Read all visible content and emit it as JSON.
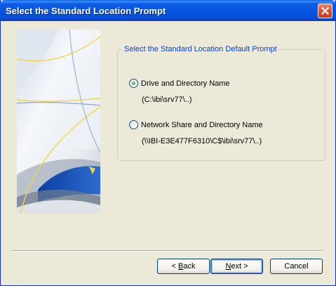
{
  "window": {
    "title": "Select the Standard Location Prompt",
    "close_label": "×"
  },
  "group": {
    "legend": "Select the Standard Location Default Prompt",
    "options": [
      {
        "label": "Drive and Directory Name",
        "path": "(C:\\ibi\\srv77\\..)",
        "checked": true
      },
      {
        "label": "Network Share and Directory Name",
        "path": "(\\\\IBI-E3E477F6310\\C$\\ibi\\srv77\\..)",
        "checked": false
      }
    ]
  },
  "buttons": {
    "back": {
      "prefix": "< ",
      "mnemonic": "B",
      "rest": "ack"
    },
    "next": {
      "mnemonic": "N",
      "rest": "ext >"
    },
    "cancel": "Cancel"
  },
  "colors": {
    "titlebar": "#0454dc",
    "dialog_bg": "#ece9d8",
    "legend_text": "#0046d5",
    "close_button": "#d5512f"
  }
}
